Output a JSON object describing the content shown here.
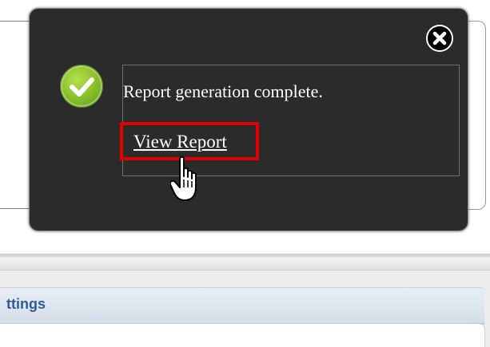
{
  "background": {
    "panel_title": "ttings"
  },
  "notification": {
    "message": "Report generation complete.",
    "link_label": "View Report",
    "status": "success",
    "icons": {
      "status": "checkmark-circle-icon",
      "close": "close-circle-icon",
      "cursor": "hand-pointer-icon"
    },
    "colors": {
      "popup_bg": "#2b2b2b",
      "success_green": "#8cc32c",
      "highlight_red": "#e00000",
      "settings_title": "#2c5d9a"
    }
  }
}
